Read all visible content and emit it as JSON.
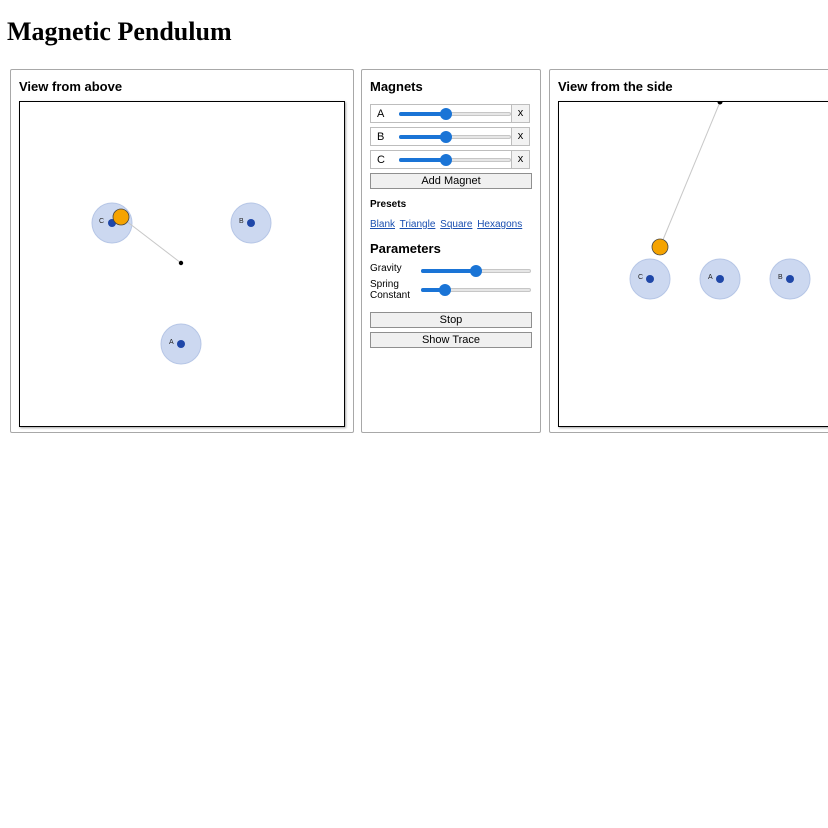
{
  "page": {
    "title": "Magnetic Pendulum"
  },
  "views": {
    "top_title": "View from above",
    "side_title": "View from the side"
  },
  "magnets": {
    "heading": "Magnets",
    "items": [
      {
        "name": "A",
        "strength": 0.42,
        "delete_label": "x"
      },
      {
        "name": "B",
        "strength": 0.42,
        "delete_label": "x"
      },
      {
        "name": "C",
        "strength": 0.42,
        "delete_label": "x"
      }
    ],
    "add_label": "Add Magnet"
  },
  "presets": {
    "heading": "Presets",
    "items": [
      "Blank",
      "Triangle",
      "Square",
      "Hexagons"
    ]
  },
  "parameters": {
    "heading": "Parameters",
    "gravity_label": "Gravity",
    "gravity_value": 0.5,
    "spring_label_line1": "Spring",
    "spring_label_line2": "Constant",
    "spring_value": 0.22
  },
  "buttons": {
    "stop_label": "Stop",
    "trace_label": "Show Trace"
  },
  "colors": {
    "slider_accent": "#1a74d6",
    "magnet_halo": "#ccd8f0",
    "magnet_core": "#1f47a8",
    "bob": "#f5a300",
    "link": "#1a4fb0"
  }
}
